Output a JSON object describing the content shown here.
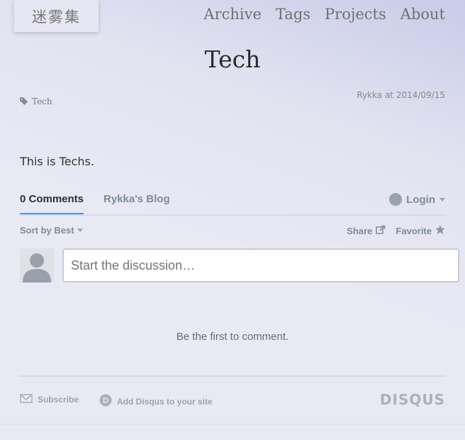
{
  "site": {
    "logo": "迷雾集"
  },
  "nav": {
    "items": [
      "Archive",
      "Tags",
      "Projects",
      "About"
    ]
  },
  "post": {
    "title": "Tech",
    "tag": "Tech",
    "meta": "Rykka at 2014/09/15",
    "body": "This is Techs."
  },
  "disqus": {
    "tab_comments": "0 Comments",
    "tab_blog": "Rykka's Blog",
    "login": "Login",
    "sort": "Sort by Best",
    "share": "Share",
    "favorite": "Favorite",
    "placeholder": "Start the discussion…",
    "empty": "Be the first to comment.",
    "subscribe": "Subscribe",
    "add_disqus": "Add Disqus to your site",
    "brand": "DISQUS",
    "accent": "#2e9fff"
  }
}
